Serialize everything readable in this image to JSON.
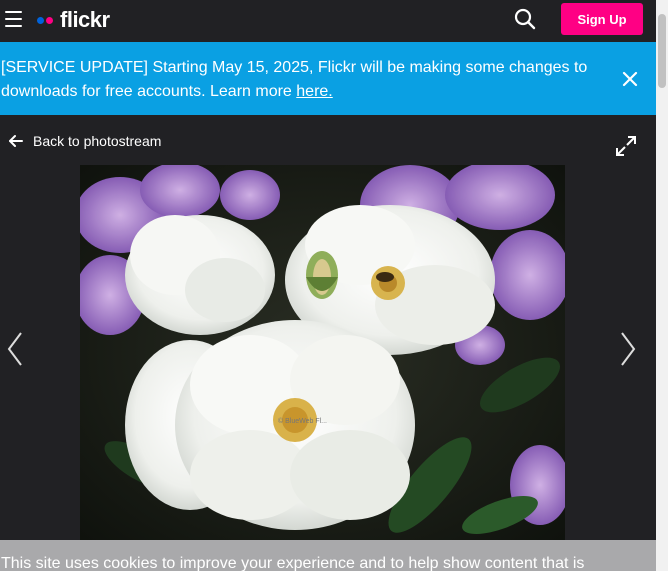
{
  "header": {
    "logo_text": "flickr",
    "signup_label": "Sign Up",
    "colors": {
      "blue_dot": "#0063dc",
      "pink_dot": "#ff0084",
      "signup_bg": "#ff0084"
    }
  },
  "banner": {
    "text": "[SERVICE UPDATE] Starting May 15, 2025, Flickr will be making some changes to downloads for free accounts. Learn more ",
    "link_text": "here.",
    "bg_color": "#0aa0e3"
  },
  "nav": {
    "back_label": "Back to photostream"
  },
  "photo": {
    "watermark": "© BlueWeb Fl..."
  },
  "cookie": {
    "text": "This site uses cookies to improve your experience and to help show content that is"
  },
  "icons": [
    "hamburger-icon",
    "search-icon",
    "close-icon",
    "arrow-left-icon",
    "expand-icon",
    "chevron-left-icon",
    "chevron-right-icon"
  ]
}
